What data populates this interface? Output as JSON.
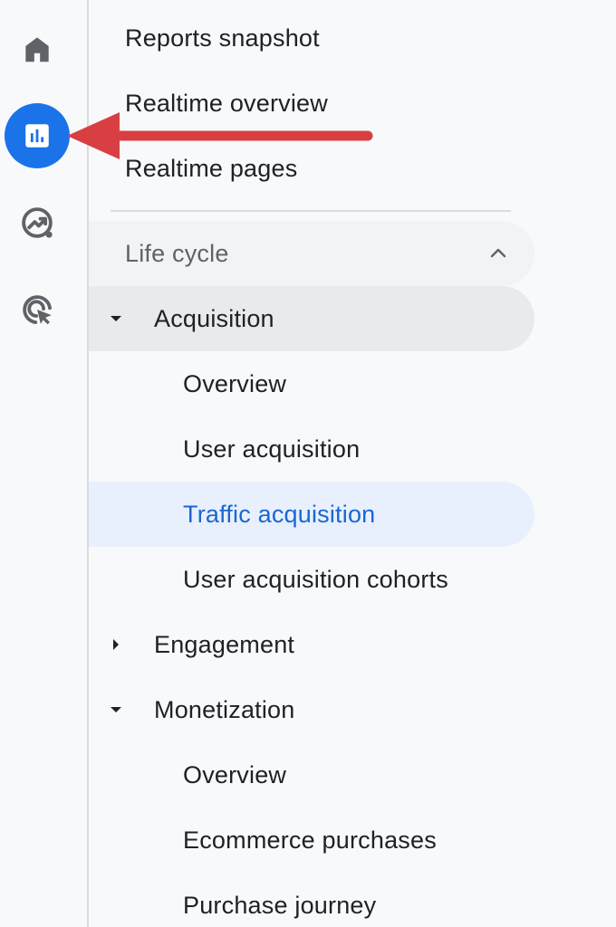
{
  "rail": {
    "items": [
      {
        "icon": "home-icon",
        "active": false
      },
      {
        "icon": "reports-bar-chart-icon",
        "active": true
      },
      {
        "icon": "explore-trend-icon",
        "active": false
      },
      {
        "icon": "advertising-target-cursor-icon",
        "active": false
      }
    ],
    "active_color": "#1a73e8"
  },
  "nav": {
    "reports_snapshot": "Reports snapshot",
    "realtime_overview": "Realtime overview",
    "realtime_pages": "Realtime pages",
    "life_cycle": {
      "label": "Life cycle",
      "expanded": true
    },
    "acquisition": {
      "label": "Acquisition",
      "expanded": true,
      "children": {
        "overview": "Overview",
        "user_acquisition": "User acquisition",
        "traffic_acquisition": "Traffic acquisition",
        "user_acquisition_cohorts": "User acquisition cohorts"
      }
    },
    "engagement": {
      "label": "Engagement",
      "expanded": false
    },
    "monetization": {
      "label": "Monetization",
      "expanded": true,
      "children": {
        "overview": "Overview",
        "ecommerce_purchases": "Ecommerce purchases",
        "purchase_journey": "Purchase journey"
      }
    },
    "active_item": "Traffic acquisition",
    "active_color": "#1967d2"
  },
  "annotation": {
    "arrow_color": "#d93f42"
  }
}
